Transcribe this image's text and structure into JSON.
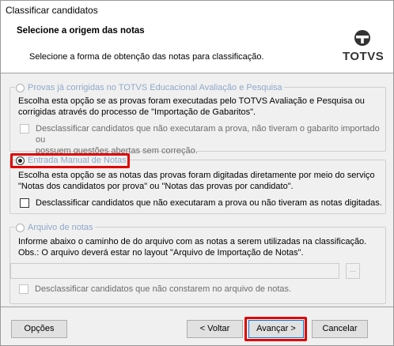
{
  "window": {
    "title": "Classificar candidatos"
  },
  "header": {
    "title": "Selecione a origem das notas",
    "subtitle": "Selecione a forma de obtenção das notas para classificação.",
    "logo_text": "TOTVS"
  },
  "options": [
    {
      "label": "Provas já corrigidas no TOTVS Educacional Avaliação e Pesquisa",
      "selected": false,
      "enabled": false,
      "description_lines": [
        "Escolha esta opção se as provas foram executadas pelo TOTVS Avaliação e Pesquisa ou",
        "corrigidas através do processo de \"Importação de Gabaritos\"."
      ],
      "checkbox_lines": [
        "Desclassificar candidatos que não executaram a prova, não tiveram o gabarito importado ou",
        "possuem questões abertas sem correção."
      ],
      "checkbox_checked": false
    },
    {
      "label": "Entrada Manual de Notas",
      "selected": true,
      "enabled": true,
      "description_lines": [
        "Escolha esta opção se as notas das provas foram digitadas diretamente por meio do serviço",
        "\"Notas dos candidatos por prova\" ou  \"Notas das provas por candidato\"."
      ],
      "checkbox_lines": [
        "Desclassificar candidatos que não executaram a prova ou não tiveram as notas digitadas."
      ],
      "checkbox_checked": false
    },
    {
      "label": "Arquivo de notas",
      "selected": false,
      "enabled": false,
      "description_lines": [
        "Informe abaixo o caminho de do arquivo com as notas a serem utilizadas na classificação.",
        "Obs.: O arquivo deverá estar no layout \"Arquivo de Importação de Notas\"."
      ],
      "file_path": "",
      "browse_label": "...",
      "checkbox_lines": [
        "Desclassificar candidatos que não constarem no arquivo de notas."
      ],
      "checkbox_checked": false
    }
  ],
  "footer": {
    "options_label": "Opções",
    "back_label": "< Voltar",
    "next_label": "Avançar >",
    "cancel_label": "Cancelar"
  },
  "colors": {
    "highlight": "#e00000",
    "disabled_label": "#8fa8c8",
    "default_button_border": "#0078d7"
  }
}
